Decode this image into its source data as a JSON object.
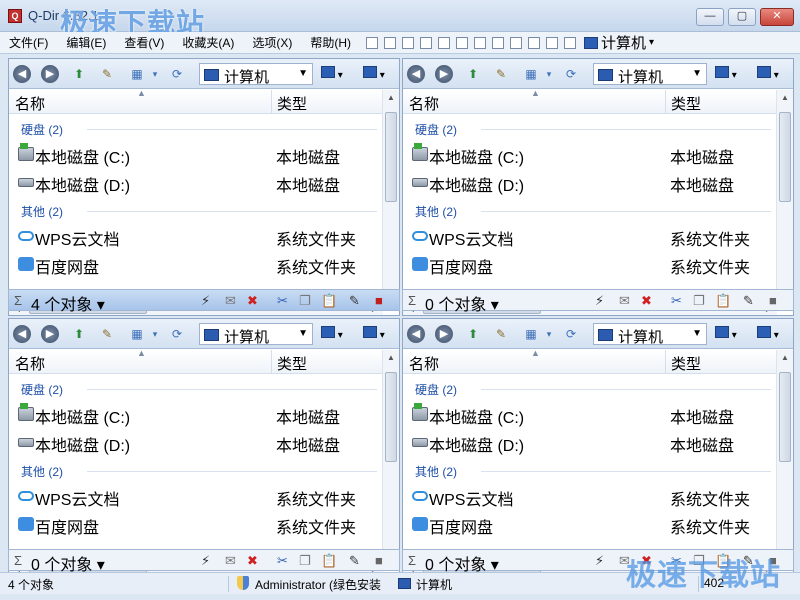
{
  "window": {
    "title": "Q-Dir 6.82.1",
    "watermark": "极速下载站",
    "controls": [
      "—",
      "▢",
      "✕"
    ]
  },
  "menu": {
    "items": [
      "文件(F)",
      "编辑(E)",
      "查看(V)",
      "收藏夹(A)",
      "选项(X)",
      "帮助(H)"
    ],
    "computer_label": "计算机"
  },
  "panes": [
    {
      "address": "计算机",
      "columns": {
        "name": "名称",
        "type": "类型"
      },
      "groups": [
        {
          "label": "硬盘 (2)",
          "items": [
            {
              "name": "本地磁盘 (C:)",
              "type": "本地磁盘",
              "icon": "system-drive-icon"
            },
            {
              "name": "本地磁盘 (D:)",
              "type": "本地磁盘",
              "icon": "drive-icon"
            }
          ]
        },
        {
          "label": "其他 (2)",
          "items": [
            {
              "name": "WPS云文档",
              "type": "系统文件夹",
              "icon": "cloud-icon"
            },
            {
              "name": "百度网盘",
              "type": "系统文件夹",
              "icon": "baidu-netdisk-icon"
            }
          ]
        }
      ],
      "status": "4 个对象 ▾",
      "active": true
    },
    {
      "address": "计算机",
      "columns": {
        "name": "名称",
        "type": "类型"
      },
      "groups": [
        {
          "label": "硬盘 (2)",
          "items": [
            {
              "name": "本地磁盘 (C:)",
              "type": "本地磁盘",
              "icon": "system-drive-icon"
            },
            {
              "name": "本地磁盘 (D:)",
              "type": "本地磁盘",
              "icon": "drive-icon"
            }
          ]
        },
        {
          "label": "其他 (2)",
          "items": [
            {
              "name": "WPS云文档",
              "type": "系统文件夹",
              "icon": "cloud-icon"
            },
            {
              "name": "百度网盘",
              "type": "系统文件夹",
              "icon": "baidu-netdisk-icon"
            }
          ]
        }
      ],
      "status": "0 个对象 ▾",
      "active": false
    },
    {
      "address": "计算机",
      "columns": {
        "name": "名称",
        "type": "类型"
      },
      "groups": [
        {
          "label": "硬盘 (2)",
          "items": [
            {
              "name": "本地磁盘 (C:)",
              "type": "本地磁盘",
              "icon": "system-drive-icon"
            },
            {
              "name": "本地磁盘 (D:)",
              "type": "本地磁盘",
              "icon": "drive-icon"
            }
          ]
        },
        {
          "label": "其他 (2)",
          "items": [
            {
              "name": "WPS云文档",
              "type": "系统文件夹",
              "icon": "cloud-icon"
            },
            {
              "name": "百度网盘",
              "type": "系统文件夹",
              "icon": "baidu-netdisk-icon"
            }
          ]
        }
      ],
      "status": "0 个对象 ▾",
      "active": false
    },
    {
      "address": "计算机",
      "columns": {
        "name": "名称",
        "type": "类型"
      },
      "groups": [
        {
          "label": "硬盘 (2)",
          "items": [
            {
              "name": "本地磁盘 (C:)",
              "type": "本地磁盘",
              "icon": "system-drive-icon"
            },
            {
              "name": "本地磁盘 (D:)",
              "type": "本地磁盘",
              "icon": "drive-icon"
            }
          ]
        },
        {
          "label": "其他 (2)",
          "items": [
            {
              "name": "WPS云文档",
              "type": "系统文件夹",
              "icon": "cloud-icon"
            },
            {
              "name": "百度网盘",
              "type": "系统文件夹",
              "icon": "baidu-netdisk-icon"
            }
          ]
        }
      ],
      "status": "0 个对象 ▾",
      "active": false
    }
  ],
  "statusbar": {
    "count": "4 个对象",
    "user": "Administrator (绿色安装",
    "location": "计算机",
    "right_value": "402"
  },
  "colors": {
    "accent": "#1e4fa8",
    "active_status": "#a7c4ea",
    "title_bg": "#c6d7ec"
  }
}
